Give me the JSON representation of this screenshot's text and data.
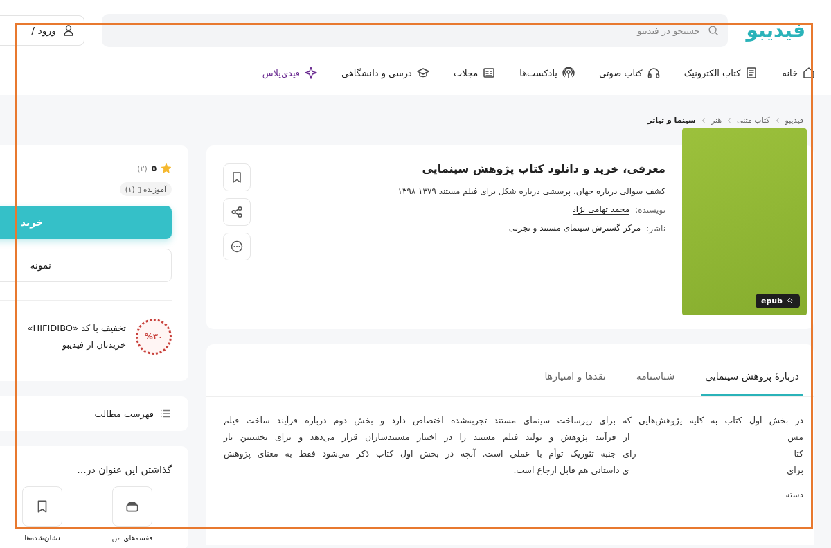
{
  "header": {
    "logo": "فیدیبو",
    "search": {
      "placeholder": "جستجو در فیدیبو"
    },
    "login": "ورود /"
  },
  "nav": [
    {
      "label": "خانه",
      "kind": "link"
    },
    {
      "label": "کتاب الکترونیک",
      "kind": "link"
    },
    {
      "label": "کتاب صوتی",
      "kind": "link"
    },
    {
      "label": "پادکست‌ها",
      "kind": "link"
    },
    {
      "label": "مجلات",
      "kind": "link"
    },
    {
      "label": "درسی و دانشگاهی",
      "kind": "link"
    },
    {
      "label": "فیدی‌پلاس",
      "kind": "plus"
    }
  ],
  "breadcrumb": [
    {
      "label": "فیدیبو",
      "current": false
    },
    {
      "label": "کتاب متنی",
      "current": false
    },
    {
      "label": "هنر",
      "current": false
    },
    {
      "label": "سینما و تیاتر",
      "current": true
    }
  ],
  "book": {
    "title": "معرفی، خرید و دانلود کتاب پژوهش سینمایی",
    "subtitle": "کشف سوالی درباره جهان، پرسشی درباره شکل برای فیلم مستند ۱۳۷۹ ۱۳۹۸",
    "author_label": "نویسنده:",
    "author": "محمد تهامی نژاد",
    "publisher_label": "ناشر:",
    "publisher": "مرکز گسترش سینمای مستند و تجربی",
    "format": "epub"
  },
  "tabs": [
    {
      "label": "دربارهٔ پژوهش سینمایی",
      "selected": true
    },
    {
      "label": "شناسنامه",
      "selected": false
    },
    {
      "label": "نقدها و امتیازها",
      "selected": false
    }
  ],
  "description": [
    {
      "segments": [
        "در بخش اول کتاب به کلیه پژوهش‌هایی که برای زیرساخت سینمای مستند تجربه‌شده اختصاص دارد و بخش دوم درباره فرآیند ساخت فیلم"
      ]
    },
    {
      "segments": [
        "مس",
        "از فرآیند پژوهش و تولید فیلم مستند را در اختیار مستندسازان قرار می‌دهد و برای نخستین بار"
      ]
    },
    {
      "segments": [
        "کتا",
        "رای جنبه تئوریک توأم با عملی است. آنچه در بخش اول کتاب ذکر می‌شود فقط به معنای پژوهش"
      ]
    },
    {
      "segments": [
        "برای",
        "ی داستانی هم قابل ارجاع است."
      ]
    }
  ],
  "category_label": "دسته",
  "sidebar": {
    "rating": "۵",
    "rating_count": "(۲)",
    "tag": "آموزنده ▯ (۱)",
    "buy": "خرید",
    "sample": "نمونه",
    "discount": {
      "badge": "%۳۰",
      "lines": [
        "تخفیف با کد «HIFIDIBO»",
        "خریدتان از فیدیبو"
      ]
    },
    "toc": "فهرست مطالب",
    "save": {
      "title": "گذاشتن این عنوان در...",
      "options": [
        {
          "label": "قفسه‌های من"
        },
        {
          "label": "نشان‌شده‌ها"
        }
      ]
    }
  }
}
